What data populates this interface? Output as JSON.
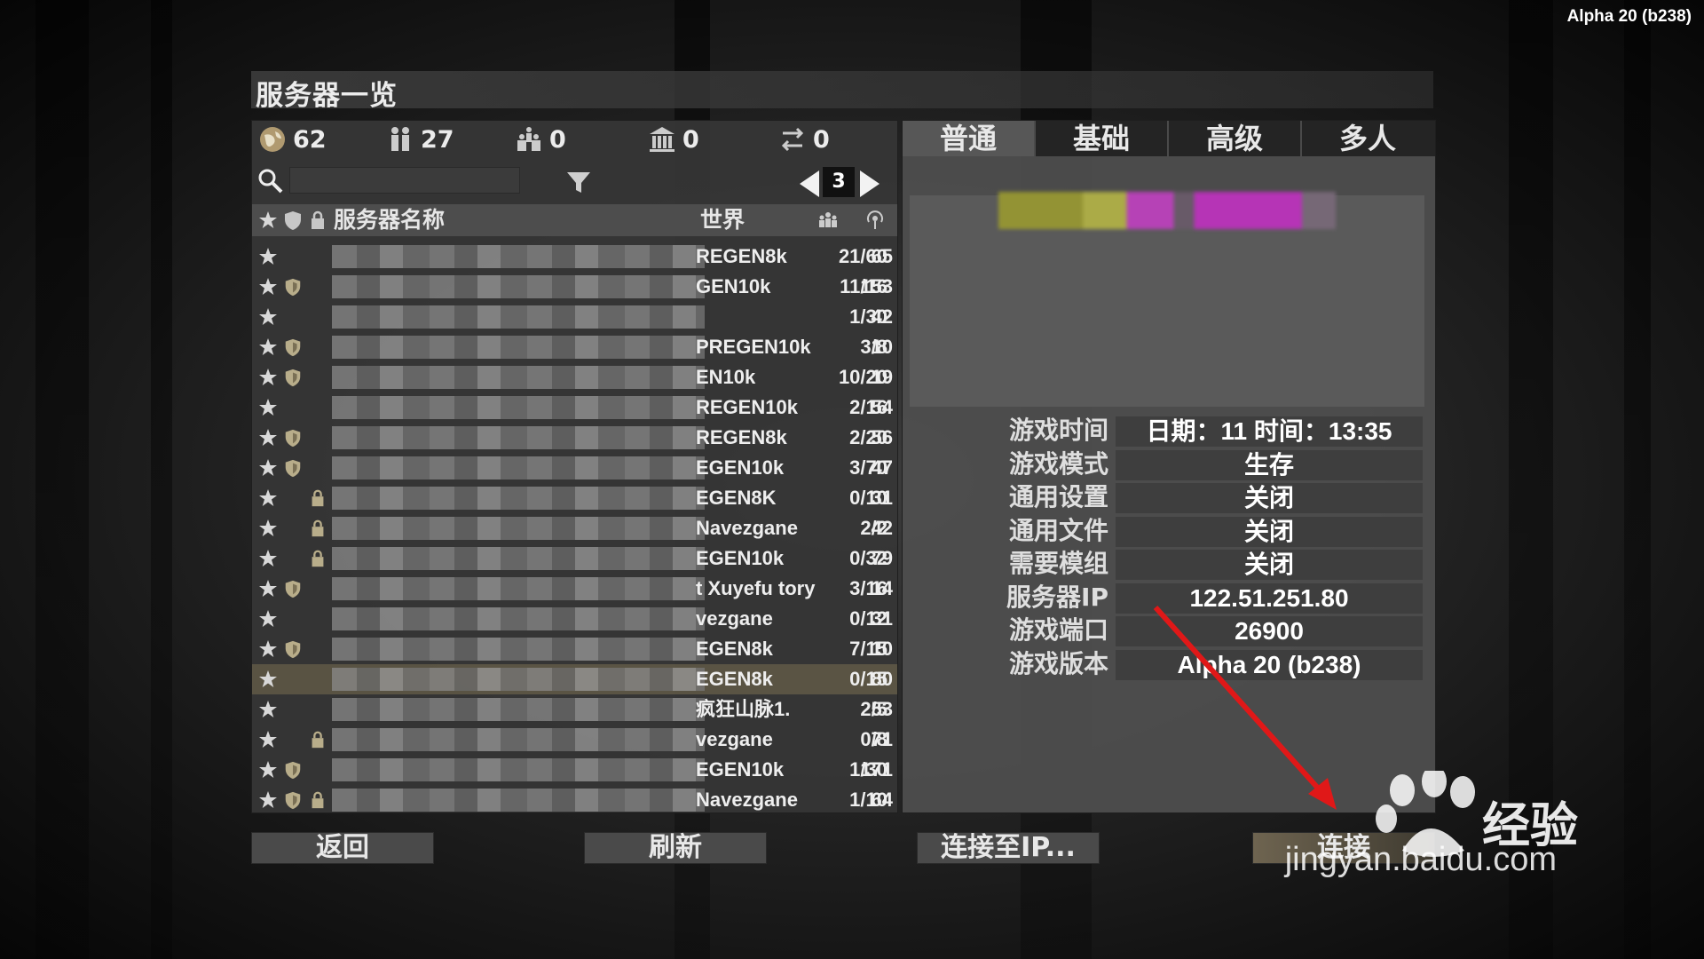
{
  "version": "Alpha 20 (b238)",
  "title": "服务器一览",
  "stats": {
    "global": "62",
    "players": "27",
    "groups": "0",
    "lan": "0",
    "history": "0"
  },
  "search": {
    "value": "",
    "placeholder": ""
  },
  "pager": {
    "page": "3"
  },
  "columns": {
    "name": "服务器名称",
    "world": "世界"
  },
  "rows": [
    {
      "world": "REGEN8k",
      "players": "21/60",
      "ping": "65",
      "shield": false,
      "lock": false
    },
    {
      "world": "GEN10k",
      "players": "11/16",
      "ping": "153",
      "shield": true,
      "lock": false
    },
    {
      "world": "",
      "players": "1/30",
      "ping": "42",
      "shield": false,
      "lock": false
    },
    {
      "world": "PREGEN10k",
      "players": "3/8",
      "ping": "10",
      "shield": true,
      "lock": false
    },
    {
      "world": "EN10k",
      "players": "10/20",
      "ping": "19",
      "shield": true,
      "lock": false
    },
    {
      "world": "REGEN10k",
      "players": "2/16",
      "ping": "54",
      "shield": false,
      "lock": false
    },
    {
      "world": "REGEN8k",
      "players": "2/20",
      "ping": "56",
      "shield": true,
      "lock": false
    },
    {
      "world": "EGEN10k",
      "players": "3/70",
      "ping": "47",
      "shield": true,
      "lock": false
    },
    {
      "world": "EGEN8K",
      "players": "0/10",
      "ping": "31",
      "shield": false,
      "lock": true
    },
    {
      "world": "Navezgane",
      "players": "2/2",
      "ping": "42",
      "shield": false,
      "lock": true
    },
    {
      "world": "EGEN10k",
      "players": "0/32",
      "ping": "79",
      "shield": false,
      "lock": true
    },
    {
      "world": "t Xuyefu tory",
      "players": "3/16",
      "ping": "14",
      "shield": true,
      "lock": false
    },
    {
      "world": "vezgane",
      "players": "0/12",
      "ping": "31",
      "shield": false,
      "lock": false
    },
    {
      "world": "EGEN8k",
      "players": "7/15",
      "ping": "10",
      "shield": true,
      "lock": false
    },
    {
      "world": "EGEN8k",
      "players": "0/15",
      "ping": "80",
      "shield": false,
      "lock": false,
      "selected": true
    },
    {
      "world": "疯狂山脉1.",
      "players": "2/5",
      "ping": "53",
      "shield": false,
      "lock": false
    },
    {
      "world": "vezgane",
      "players": "0/8",
      "ping": "71",
      "shield": false,
      "lock": true
    },
    {
      "world": "EGEN10k",
      "players": "1/30",
      "ping": "171",
      "shield": true,
      "lock": false
    },
    {
      "world": "Navezgane",
      "players": "1/10",
      "ping": "64",
      "shield": true,
      "lock": true
    }
  ],
  "tabs": [
    "普通",
    "基础",
    "高级",
    "多人"
  ],
  "info": [
    {
      "label": "游戏时间",
      "value": "日期：11 时间：13:35"
    },
    {
      "label": "游戏模式",
      "value": "生存"
    },
    {
      "label": "通用设置",
      "value": "关闭"
    },
    {
      "label": "通用文件",
      "value": "关闭"
    },
    {
      "label": "需要模组",
      "value": "关闭"
    },
    {
      "label": "服务器IP",
      "value": "122.51.251.80"
    },
    {
      "label": "游戏端口",
      "value": "26900"
    },
    {
      "label": "游戏版本",
      "value": "Alpha 20 (b238)"
    }
  ],
  "buttons": {
    "back": "返回",
    "refresh": "刷新",
    "connect_ip": "连接至IP...",
    "connect": "连接"
  },
  "watermark": {
    "site": "jingyan.baidu.com",
    "brand": "经验"
  },
  "colors": {
    "accent_arrow": "#e01818",
    "selected_row": "#786e50"
  }
}
